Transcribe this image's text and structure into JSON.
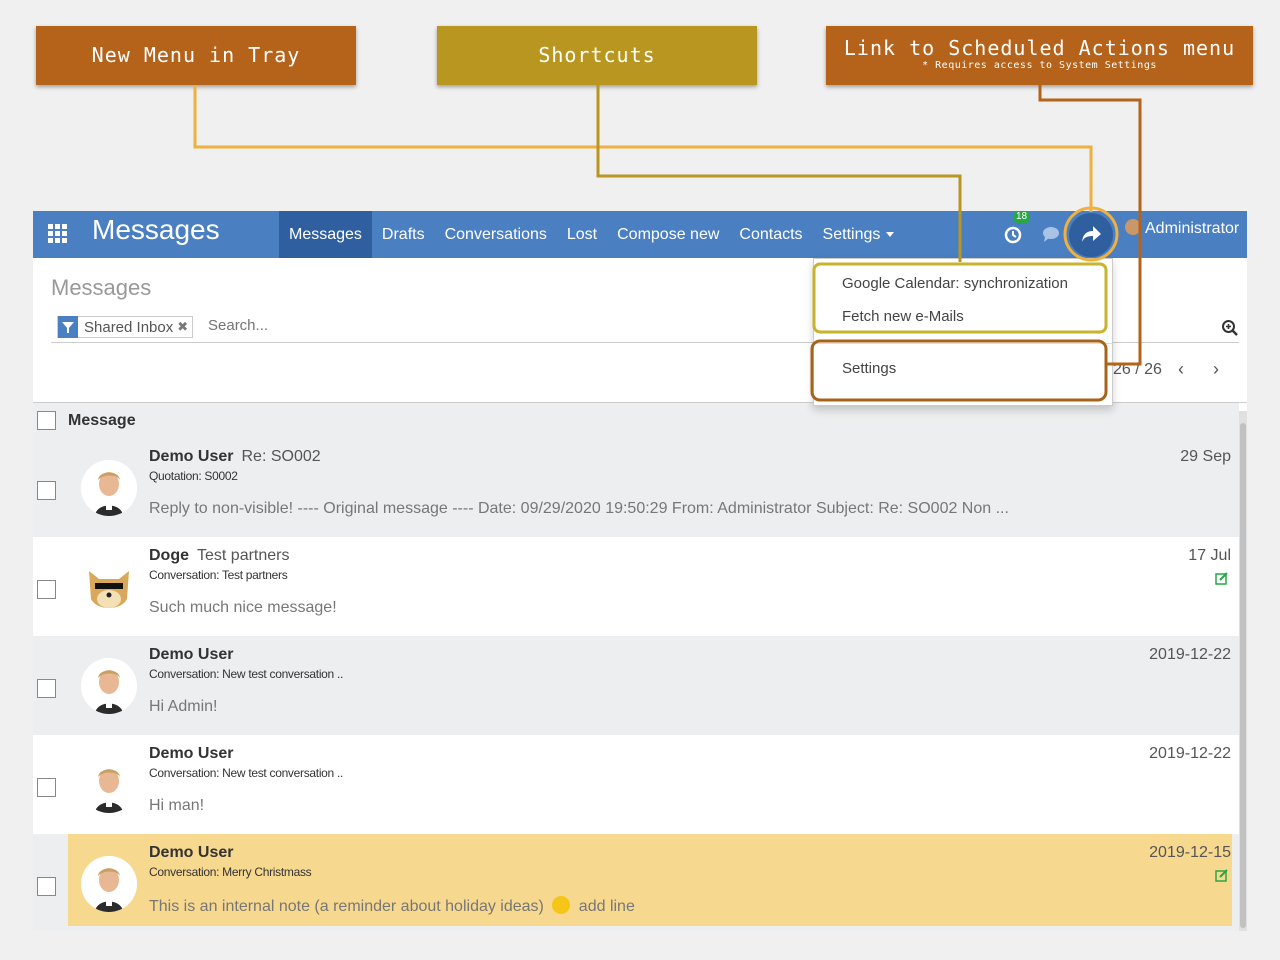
{
  "callouts": {
    "new_menu": "New Menu in Tray",
    "shortcuts": "Shortcuts",
    "scheduled": "Link to Scheduled Actions menu",
    "scheduled_note": "* Requires access to System Settings"
  },
  "navbar": {
    "app_title": "Messages",
    "menu": [
      "Messages",
      "Drafts",
      "Conversations",
      "Lost",
      "Compose new",
      "Contacts",
      "Settings"
    ],
    "activity_badge": "18",
    "user": "Administrator"
  },
  "control_panel": {
    "breadcrumb": "Messages",
    "facet": "Shared Inbox",
    "search_placeholder": "Search...",
    "pager": "26 / 26"
  },
  "dropdown": {
    "items": [
      "Google Calendar: synchronization",
      "Fetch new e-Mails",
      "Settings"
    ]
  },
  "list": {
    "header": "Message",
    "rows": [
      {
        "author": "Demo User",
        "subject": "Re: SO002",
        "ref": "Quotation: S0002",
        "body": "Reply to non-visible! ---- Original message ---- Date: 09/29/2020 19:50:29 From: Administrator Subject: Re: SO002 Non ...",
        "date": "29 Sep"
      },
      {
        "author": "Doge",
        "subject": "Test partners",
        "ref": "Conversation: Test partners",
        "body": "Such much nice message!",
        "date": "17 Jul"
      },
      {
        "author": "Demo User",
        "subject": "",
        "ref": "Conversation: New test conversation ..",
        "body": "Hi Admin!",
        "date": "2019-12-22"
      },
      {
        "author": "Demo User",
        "subject": "",
        "ref": "Conversation: New test conversation ..",
        "body": "Hi man!",
        "date": "2019-12-22"
      },
      {
        "author": "Demo User",
        "subject": "",
        "ref": "Conversation: Merry Christmass",
        "body": "This is an internal note (a reminder about holiday ideas)",
        "body_extra": "add line",
        "date": "2019-12-15"
      }
    ]
  },
  "colors": {
    "navbar": "#4a7fc1",
    "callout_orange": "#b5621a",
    "callout_gold": "#b8961f",
    "highlight_row": "#f7d88f"
  }
}
